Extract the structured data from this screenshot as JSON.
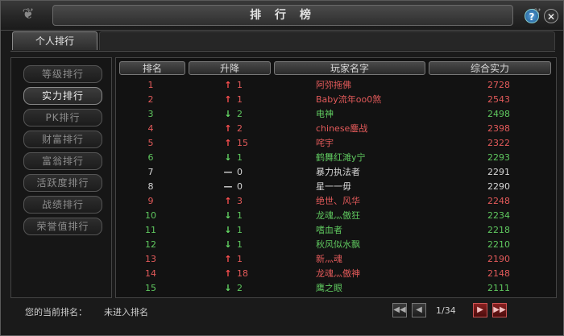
{
  "window": {
    "title": "排 行 榜",
    "help_label": "?",
    "close_label": "✕"
  },
  "tabs": [
    {
      "label": "个人排行"
    }
  ],
  "categories": [
    "等级排行",
    "实力排行",
    "PK排行",
    "财富排行",
    "富翁排行",
    "活跃度排行",
    "战绩排行",
    "荣誉值排行"
  ],
  "active_category": 1,
  "table": {
    "headers": {
      "rank": "排名",
      "change": "升降",
      "name": "玩家名字",
      "power": "综合实力"
    },
    "rows": [
      {
        "rank": "1",
        "dir": "up",
        "change": "1",
        "name": "阿弥拖佛",
        "power": "2728"
      },
      {
        "rank": "2",
        "dir": "up",
        "change": "1",
        "name": "Baby流年oo0煞",
        "power": "2543"
      },
      {
        "rank": "3",
        "dir": "down",
        "change": "2",
        "name": "电神",
        "power": "2498"
      },
      {
        "rank": "4",
        "dir": "up",
        "change": "2",
        "name": "chinese鏖战",
        "power": "2398"
      },
      {
        "rank": "5",
        "dir": "up",
        "change": "15",
        "name": "咤宇",
        "power": "2322"
      },
      {
        "rank": "6",
        "dir": "down",
        "change": "1",
        "name": "鹤舞红滩y宁",
        "power": "2293"
      },
      {
        "rank": "7",
        "dir": "none",
        "change": "0",
        "name": "暴力执法者",
        "power": "2291"
      },
      {
        "rank": "8",
        "dir": "none",
        "change": "0",
        "name": "星一一毋",
        "power": "2290"
      },
      {
        "rank": "9",
        "dir": "up",
        "change": "3",
        "name": "绝世、风华",
        "power": "2248"
      },
      {
        "rank": "10",
        "dir": "down",
        "change": "1",
        "name": "龙魂灬傲狂",
        "power": "2234"
      },
      {
        "rank": "11",
        "dir": "down",
        "change": "1",
        "name": "嗜血者",
        "power": "2218"
      },
      {
        "rank": "12",
        "dir": "down",
        "change": "1",
        "name": "秋风似水飘",
        "power": "2210"
      },
      {
        "rank": "13",
        "dir": "up",
        "change": "1",
        "name": "新灬魂",
        "power": "2190"
      },
      {
        "rank": "14",
        "dir": "up",
        "change": "18",
        "name": "龙魂灬傲神",
        "power": "2148"
      },
      {
        "rank": "15",
        "dir": "down",
        "change": "2",
        "name": "鹰之眼",
        "power": "2111"
      }
    ]
  },
  "footer": {
    "current_rank_label": "您的当前排名：",
    "current_rank_value": "未进入排名",
    "page": "1/34"
  },
  "colors": {
    "up": "#e35a5a",
    "down": "#5fc85f",
    "none": "#d8d8d8",
    "up_arrow": "#ff5050",
    "down_arrow": "#66dd66"
  }
}
